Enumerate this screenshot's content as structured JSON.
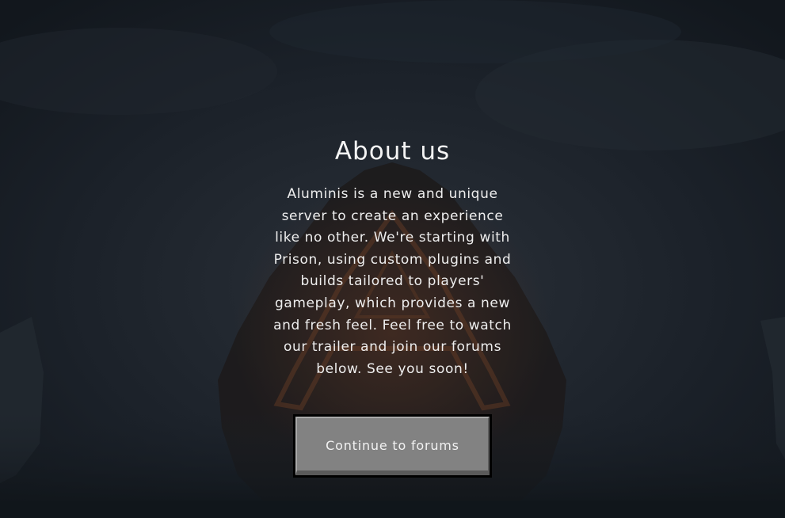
{
  "about": {
    "heading": "About us",
    "paragraph": "Aluminis is a new and unique server to create an experience like no other. We're starting with Prison, using custom plugins and builds tailored to players' gameplay, which provides a new and fresh feel. Feel free to watch our trailer and join our forums below. See you soon!",
    "button_label": "Continue to forums"
  },
  "colors": {
    "background": "#151b22",
    "text": "#f4f4f4",
    "button_face": "#828282",
    "button_frame": "#000000"
  }
}
